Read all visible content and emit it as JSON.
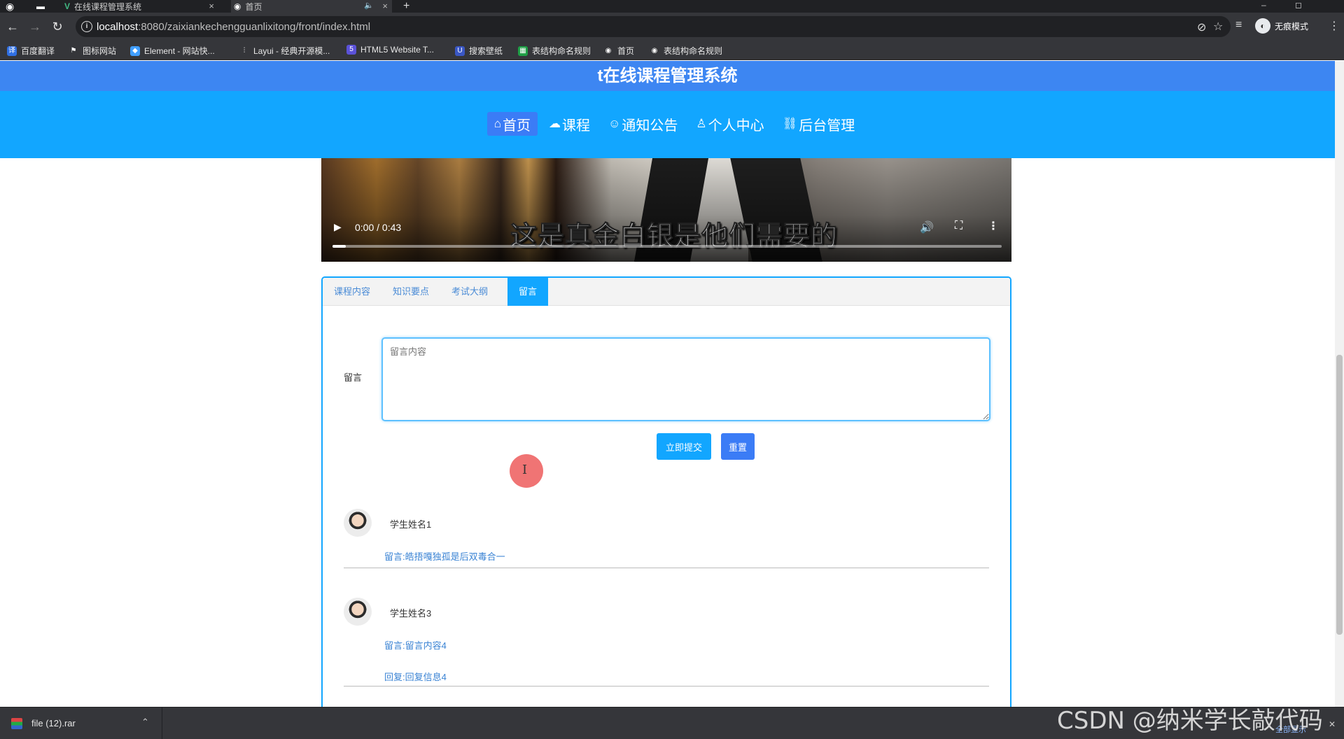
{
  "browser": {
    "tabs": [
      {
        "title": "在线课程管理系统",
        "active": false
      },
      {
        "title": "首页",
        "active": true
      }
    ],
    "new_tab": "+",
    "window_min": "–",
    "window_max": "◻",
    "url_host": "localhost",
    "url_rest": ":8080/zaixiankechengguanlixitong/front/index.html",
    "incognito_label": "无痕模式",
    "bookmarks": [
      {
        "label": "百度翻译",
        "icon": "baidu-translate-icon",
        "color": "#2f6fe3"
      },
      {
        "label": "图标网站",
        "icon": "flag-icon",
        "color": "#444444"
      },
      {
        "label": "Element - 网站快...",
        "icon": "element-icon",
        "color": "#409eff"
      },
      {
        "label": "Layui - 经典开源模...",
        "icon": "layui-icon",
        "color": "#555555"
      },
      {
        "label": "HTML5 Website T...",
        "icon": "html5-icon",
        "color": "#5b52d9"
      },
      {
        "label": "搜索壁纸",
        "icon": "wallpaper-icon",
        "color": "#3a57c4"
      },
      {
        "label": "表结构命名规则",
        "icon": "sheet-icon",
        "color": "#1e9e45"
      },
      {
        "label": "首页",
        "icon": "globe-icon",
        "color": "#444444"
      },
      {
        "label": "表结构命名规则",
        "icon": "globe-icon",
        "color": "#444444"
      }
    ]
  },
  "site": {
    "title": "t在线课程管理系统",
    "nav": [
      {
        "label": "首页",
        "icon": "⌂",
        "active": true
      },
      {
        "label": "课程",
        "icon": "☁",
        "active": false
      },
      {
        "label": "通知公告",
        "icon": "☺",
        "active": false
      },
      {
        "label": "个人中心",
        "icon": "♙",
        "active": false
      },
      {
        "label": "后台管理",
        "icon": "⛓",
        "active": false
      }
    ]
  },
  "video": {
    "time": "0:00 / 0:43",
    "subtitle": "这是真金白银是他们需要的",
    "progress": 0.02
  },
  "card": {
    "tabs": [
      {
        "label": "课程内容",
        "active": false
      },
      {
        "label": "知识要点",
        "active": false
      },
      {
        "label": "考试大纲",
        "active": false
      },
      {
        "label": "留言",
        "active": true
      }
    ],
    "form": {
      "label": "留言",
      "placeholder": "留言内容",
      "value": "",
      "submit_label": "立即提交",
      "reset_label": "重置"
    },
    "comments": [
      {
        "name": "学生姓名1",
        "message": "留言:皓捂嘎独孤是后双毒合一",
        "reply": ""
      },
      {
        "name": "学生姓名3",
        "message": "留言:留言内容4",
        "reply": "回复:回复信息4"
      }
    ]
  },
  "downloads": {
    "file_name": "file (12).rar",
    "show_all": "全部显示"
  },
  "watermark": "CSDN @纳米学长敲代码"
}
